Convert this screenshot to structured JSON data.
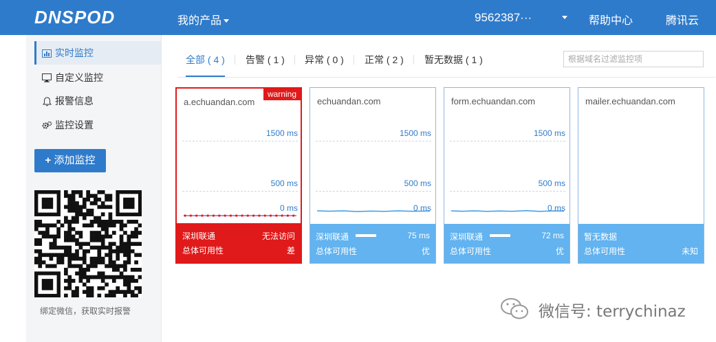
{
  "header": {
    "logo": "DNSPOD",
    "products": "我的产品",
    "account": "9562387···",
    "help": "帮助中心",
    "tencent": "腾讯云"
  },
  "sidebar": {
    "items": [
      {
        "label": "实时监控",
        "icon": "bar-chart-icon"
      },
      {
        "label": "自定义监控",
        "icon": "monitor-icon"
      },
      {
        "label": "报警信息",
        "icon": "bell-icon"
      },
      {
        "label": "监控设置",
        "icon": "gear-icon"
      }
    ],
    "add_button": "添加监控",
    "qr_caption": "绑定微信，获取实时报警"
  },
  "tabs": [
    {
      "label": "全部 ( 4 )"
    },
    {
      "label": "告警 ( 1 )"
    },
    {
      "label": "异常 ( 0 )"
    },
    {
      "label": "正常 ( 2 )"
    },
    {
      "label": "暂无数据 ( 1 )"
    }
  ],
  "search": {
    "placeholder": "根据域名过滤监控项"
  },
  "cards": [
    {
      "domain": "a.echuandan.com",
      "badge": "warning",
      "y_ticks": [
        "1500 ms",
        "500 ms",
        "0 ms"
      ],
      "location": "深圳联通",
      "value": "无法访问",
      "availability_label": "总体可用性",
      "availability": "差"
    },
    {
      "domain": "echuandan.com",
      "y_ticks": [
        "1500 ms",
        "500 ms",
        "0 ms"
      ],
      "location": "深圳联通",
      "value": "75 ms",
      "availability_label": "总体可用性",
      "availability": "优"
    },
    {
      "domain": "form.echuandan.com",
      "y_ticks": [
        "1500 ms",
        "500 ms",
        "0 ms"
      ],
      "location": "深圳联通",
      "value": "72 ms",
      "availability_label": "总体可用性",
      "availability": "优"
    },
    {
      "domain": "mailer.echuandan.com",
      "location": "暂无数据",
      "availability_label": "总体可用性",
      "availability": "未知"
    }
  ],
  "watermark": "微信号: terrychinaz",
  "colors": {
    "brand": "#2f7bcb",
    "warning": "#e0191a",
    "ok": "#62b3ef"
  }
}
